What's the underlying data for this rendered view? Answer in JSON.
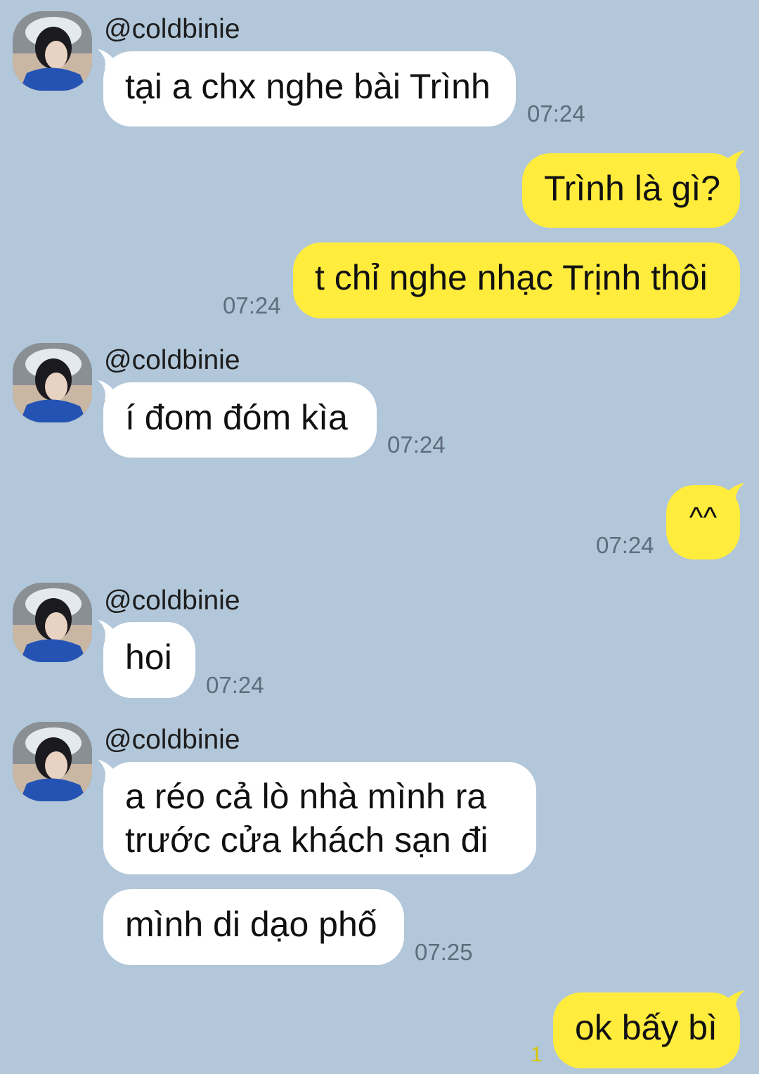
{
  "colors": {
    "background": "#b2c7da",
    "incoming_bubble": "#ffffff",
    "outgoing_bubble": "#ffec3d",
    "timestamp": "#5d6d7c",
    "unread_count": "#d9c400"
  },
  "messages": [
    {
      "from": "@coldbinie",
      "text": "tại a chx nghe bài Trình",
      "time": "07:24"
    },
    {
      "from": "me",
      "text": "Trình là gì?"
    },
    {
      "from": "me",
      "text": "t chỉ nghe nhạc Trịnh thôi",
      "time": "07:24"
    },
    {
      "from": "@coldbinie",
      "text": "í đom đóm kìa",
      "time": "07:24"
    },
    {
      "from": "me",
      "text": "^^",
      "time": "07:24"
    },
    {
      "from": "@coldbinie",
      "text": "hoi",
      "time": "07:24"
    },
    {
      "from": "@coldbinie",
      "text": "a réo cả lò nhà mình ra trước cửa khách sạn đi"
    },
    {
      "from": "@coldbinie",
      "text": "mình di dạo phố",
      "time": "07:25"
    },
    {
      "from": "me",
      "text": "ok bấy bì",
      "unread": "1"
    }
  ],
  "avatar_icon": "user-avatar-photo"
}
